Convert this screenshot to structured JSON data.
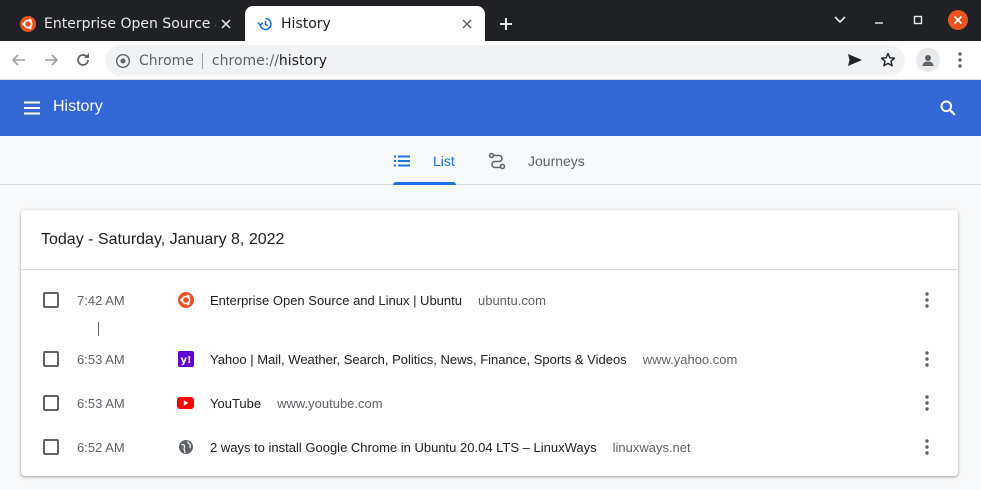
{
  "tabs": [
    {
      "title": "Enterprise Open Source and Linux | Ubuntu",
      "icon": "ubuntu-icon",
      "active": false
    },
    {
      "title": "History",
      "icon": "history-icon",
      "active": true
    }
  ],
  "omnibox": {
    "site_label": "Chrome",
    "url_scheme": "chrome://",
    "url_host": "history"
  },
  "header": {
    "title": "History"
  },
  "view_tabs": [
    {
      "label": "List",
      "selected": true
    },
    {
      "label": "Journeys",
      "selected": false
    }
  ],
  "card": {
    "title": "Today - Saturday, January 8, 2022",
    "entries": [
      {
        "time": "7:42 AM",
        "title": "Enterprise Open Source and Linux | Ubuntu",
        "domain": "ubuntu.com",
        "icon": "ubuntu-icon"
      },
      {
        "time": "6:53 AM",
        "title": "Yahoo | Mail, Weather, Search, Politics, News, Finance, Sports & Videos",
        "domain": "www.yahoo.com",
        "icon": "yahoo-icon"
      },
      {
        "time": "6:53 AM",
        "title": "YouTube",
        "domain": "www.youtube.com",
        "icon": "youtube-icon"
      },
      {
        "time": "6:52 AM",
        "title": "2 ways to install Google Chrome in Ubuntu 20.04 LTS – LinuxWays",
        "domain": "linuxways.net",
        "icon": "globe-icon"
      }
    ]
  },
  "colors": {
    "header_blue": "#3367d6",
    "accent_blue": "#1a73e8",
    "ubuntu_orange": "#e95420",
    "yahoo_purple": "#6001d2",
    "youtube_red": "#ff0000",
    "close_window_red": "#e95420"
  }
}
